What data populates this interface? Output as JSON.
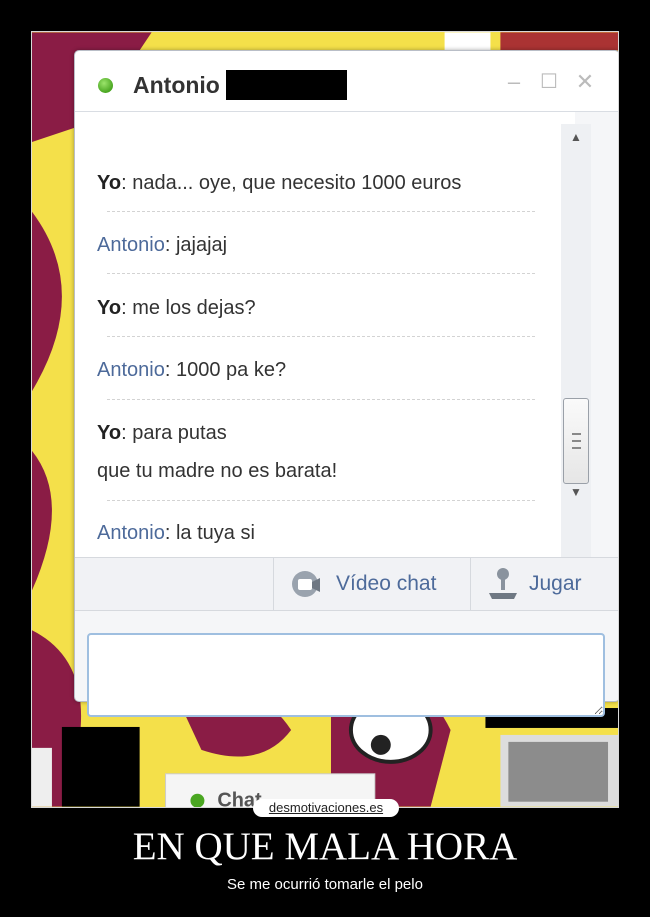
{
  "chat": {
    "contact_name": "Antonio",
    "status": "online",
    "window_controls": [
      "–",
      "☐",
      "✕"
    ],
    "messages": [
      {
        "sender": "Yo",
        "lines": [
          "nada... oye, que necesito 1000 euros"
        ]
      },
      {
        "sender": "Antonio",
        "lines": [
          "jajajaj"
        ]
      },
      {
        "sender": "Yo",
        "lines": [
          "me los dejas?"
        ]
      },
      {
        "sender": "Antonio",
        "lines": [
          "1000 pa ke?"
        ]
      },
      {
        "sender": "Yo",
        "lines": [
          "para putas",
          "que tu madre no es barata!"
        ]
      },
      {
        "sender": "Antonio",
        "lines": [
          "la tuya si"
        ]
      }
    ],
    "toolbar": {
      "video_chat_label": "Vídeo chat",
      "play_label": "Jugar"
    },
    "input_value": ""
  },
  "background_hint": "Chat",
  "watermark": "desmotivaciones.es",
  "poster": {
    "title": "EN QUE MALA HORA",
    "subtitle": "Se me ocurrió tomarle el pelo"
  },
  "colors": {
    "accent_blue": "#4d6a9a",
    "status_green": "#4aa621",
    "background_yellow": "#f4e04a",
    "background_maroon": "#8a1c45"
  }
}
